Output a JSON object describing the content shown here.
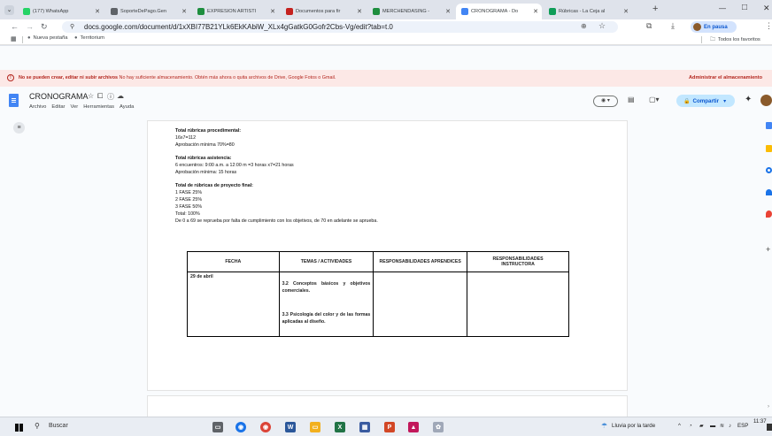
{
  "browser": {
    "tabs": [
      {
        "title": "(177) WhatsApp",
        "icon": "whatsapp-icon",
        "color": "#25d366"
      },
      {
        "title": "SoporteDePago.Gen",
        "icon": "globe-icon",
        "color": "#5f6368"
      },
      {
        "title": "EXPRESIÓN ARTÍSTI",
        "icon": "drive-icon",
        "color": "#1e8e3e"
      },
      {
        "title": "Documentos para fir",
        "icon": "gmail-icon",
        "color": "#c5221f"
      },
      {
        "title": "MERCHENDASING -",
        "icon": "drive-icon",
        "color": "#1e8e3e"
      },
      {
        "title": "CRONOGRAMA - Do",
        "icon": "docs-icon",
        "color": "#4285f4"
      },
      {
        "title": "Rúbricas - La Ceja al",
        "icon": "sheets-icon",
        "color": "#0f9d58"
      }
    ],
    "new_tab": "+",
    "window_minimize": "—",
    "window_maximize": "□",
    "window_close": "✕",
    "url": "docs.google.com/document/d/1xXBI77B21YLk6EkKAbiW_XLx4gGatkG0Gofr2Cbs-Vg/edit?tab=t.0",
    "profile_label": "En pausa",
    "bookmarks": [
      "Nueva pestaña",
      "Territorium"
    ],
    "all_bookmarks": "Todos los favoritos"
  },
  "warning": {
    "bold": "No se pueden crear, editar ni subir archivos",
    "text": " No hay suficiente almacenamiento. Obtén más ahora o quita archivos de Drive, Google Fotos o Gmail.",
    "action": "Administrar el almacenamiento"
  },
  "doc": {
    "title": "CRONOGRAMA",
    "menu": [
      "Archivo",
      "Editar",
      "Ver",
      "Herramientas",
      "Ayuda"
    ],
    "share_label": "Compartir"
  },
  "content": {
    "lines": [
      {
        "text": "Total rúbricas procedimental:",
        "bold": true
      },
      {
        "text": "16x7=112",
        "bold": false
      },
      {
        "text": "Aprobación mínima 70%=80",
        "bold": false
      },
      {
        "text": "Total rúbricas asistencia:",
        "bold": true
      },
      {
        "text": "6 encuentros: 9:00 a.m. a 12:00 m =3 horas x7=21 horas",
        "bold": false
      },
      {
        "text": "Aprobación mínima: 15 horas",
        "bold": false
      },
      {
        "text": "Total de rúbricas  de proyecto final:",
        "bold": true
      },
      {
        "text": "1 FASE 25%",
        "bold": false
      },
      {
        "text": "2 FASE 25%",
        "bold": false
      },
      {
        "text": "3 FASE 50%",
        "bold": false
      },
      {
        "text": "Total: 100%",
        "bold": false
      },
      {
        "text": "De 0 a 69 se reprueba por falta de cumplimiento con los objetivos, de 70 en adelante se aprueba.",
        "bold": false
      }
    ],
    "table": {
      "headers": [
        "FECHA",
        "TEMAS / ACTIVIDADES",
        "RESPONSABILIDADES APRENDICES",
        "RESPONSABILIDADES INSTRUCTORA"
      ],
      "row": {
        "fecha": "29 de abril",
        "tema1": "3.2 Conceptos básicos y objetivos comerciales.",
        "tema2": "3.3 Psicología del color y de las formas aplicadas al diseño.",
        "aprendices": "",
        "instructora": ""
      }
    }
  },
  "taskbar": {
    "search_placeholder": "Buscar",
    "weather": "Lluvia por la tarde",
    "lang": "ESP",
    "time": "11:37"
  },
  "colors": {
    "accent": "#0b57d0",
    "share_bg": "#c2e7ff",
    "warning_bg": "#fce8e6",
    "warning_text": "#b3261e"
  }
}
